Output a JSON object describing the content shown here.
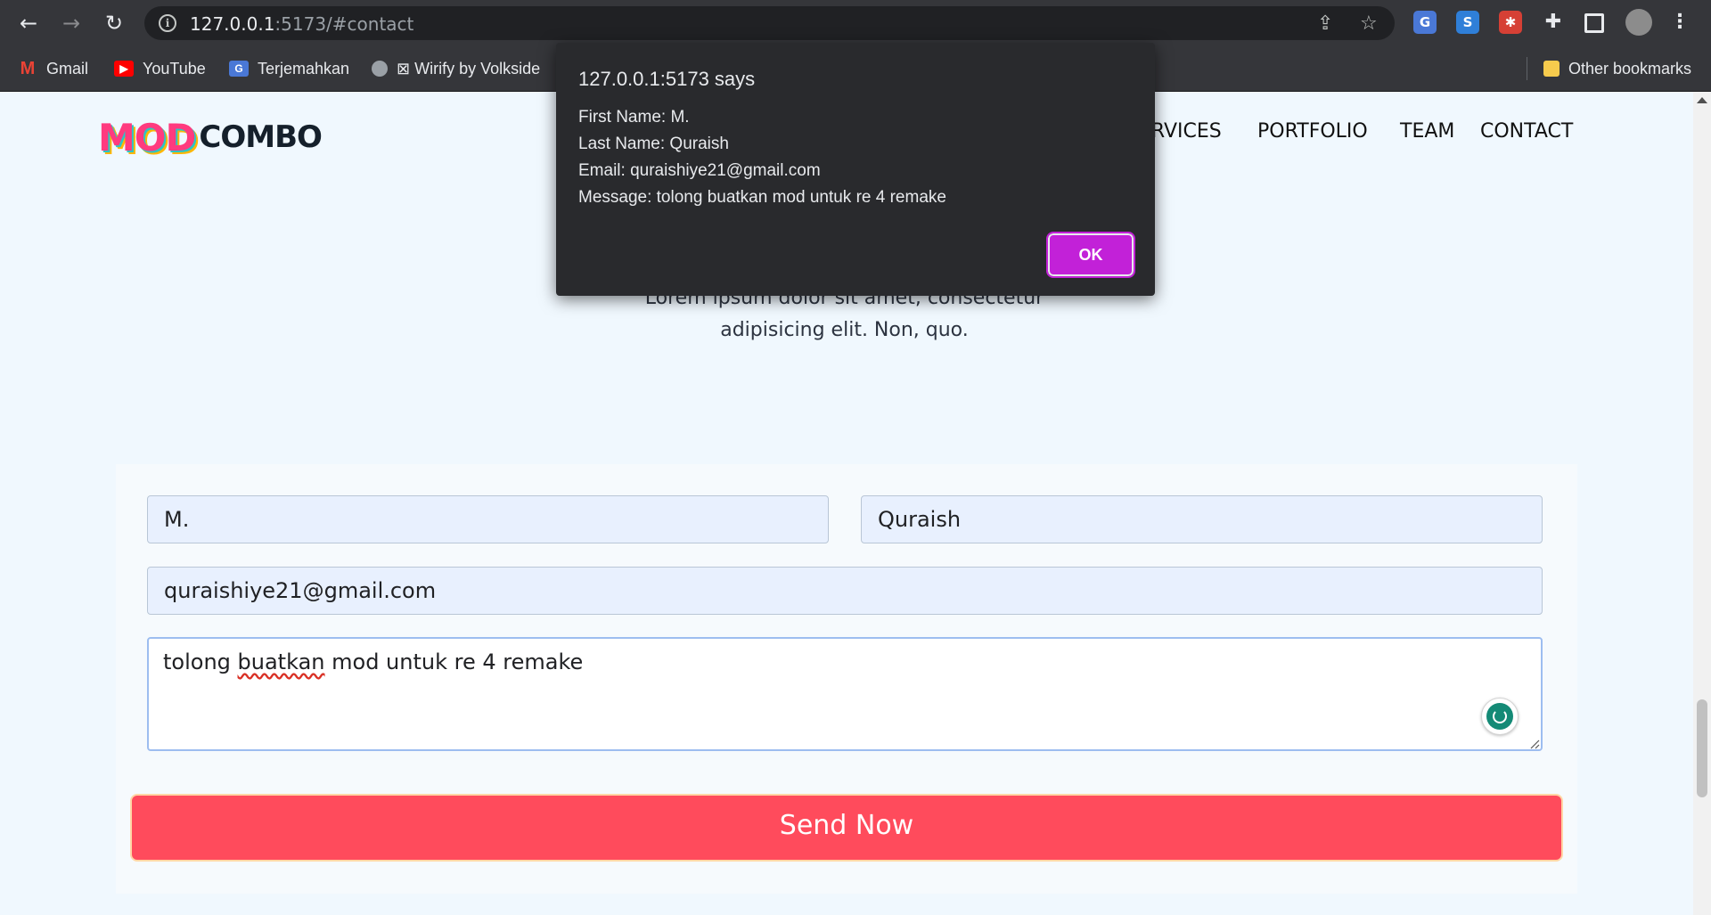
{
  "browser": {
    "url_host": "127.0.0.1",
    "url_rest": ":5173/#contact",
    "bookmarks": [
      {
        "label": "Gmail",
        "icon": "gmail-icon"
      },
      {
        "label": "YouTube",
        "icon": "youtube-icon"
      },
      {
        "label": "Terjemahkan",
        "icon": "translate-icon"
      },
      {
        "label": "⊠ Wirify by Volkside",
        "icon": "globe-icon"
      }
    ],
    "other_bookmarks": "Other bookmarks"
  },
  "header": {
    "logo_part1": "MOD",
    "logo_part2": "COMBO",
    "nav": [
      "ERVICES",
      "PORTFOLIO",
      "TEAM",
      "CONTACT"
    ]
  },
  "hero": {
    "line1": "Lorem ipsum dolor sit amet, consectetur",
    "line2": "adipisicing elit. Non, quo."
  },
  "form": {
    "first_name": "M.",
    "last_name": "Quraish",
    "email": "quraishiye21@gmail.com",
    "message_word1": "tolong ",
    "message_word2": "buatkan",
    "message_rest": " mod untuk re 4 remake",
    "send_label": "Send Now"
  },
  "dialog": {
    "title": "127.0.0.1:5173 says",
    "lines": [
      "First Name: M.",
      "Last Name: Quraish",
      "Email: quraishiye21@gmail.com",
      "Message: tolong buatkan mod untuk re 4 remake"
    ],
    "ok_label": "OK"
  },
  "colors": {
    "accent_button": "#ff4b5c",
    "dialog_ok": "#c221d8",
    "field_bg": "#e8f0fe"
  }
}
